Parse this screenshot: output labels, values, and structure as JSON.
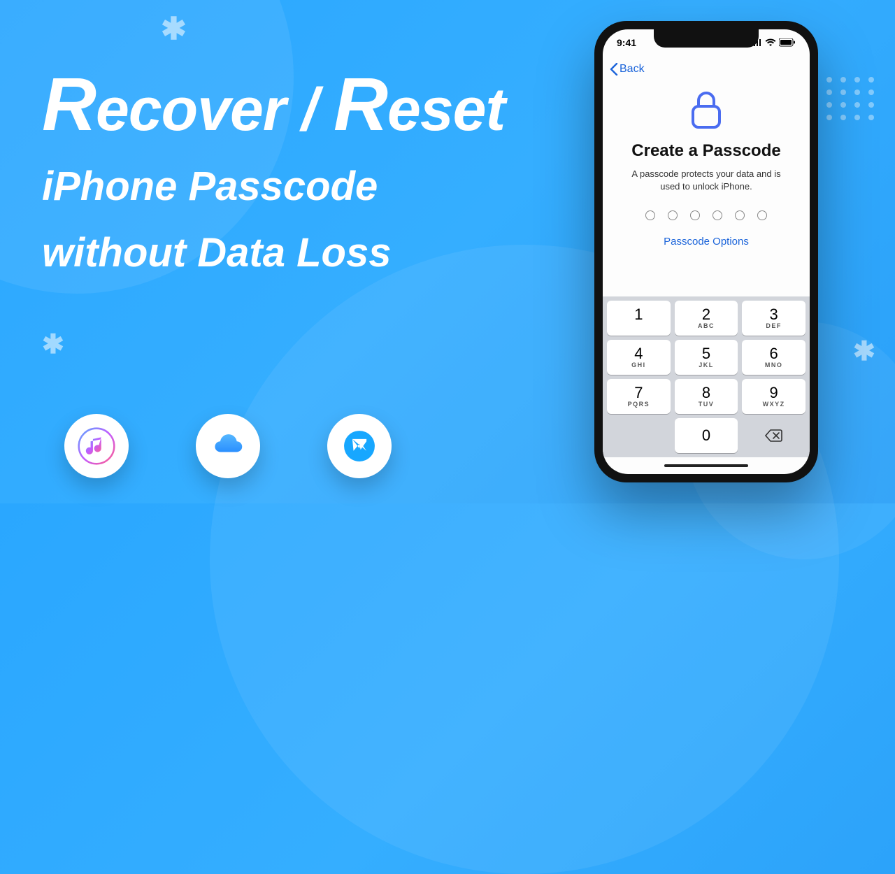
{
  "hero": {
    "line1_a": "R",
    "line1_b": "ecover / ",
    "line1_c": "R",
    "line1_d": "eset",
    "line2": "iPhone Passcode",
    "line3": "without Data Loss"
  },
  "apps": [
    "iTunes",
    "iCloud",
    "MobileTrans"
  ],
  "phone": {
    "status_time": "9:41",
    "back": "Back",
    "title": "Create a Passcode",
    "subtitle": "A passcode protects your data and is used to unlock iPhone.",
    "options": "Passcode Options",
    "keys": [
      {
        "n": "1",
        "l": ""
      },
      {
        "n": "2",
        "l": "ABC"
      },
      {
        "n": "3",
        "l": "DEF"
      },
      {
        "n": "4",
        "l": "GHI"
      },
      {
        "n": "5",
        "l": "JKL"
      },
      {
        "n": "6",
        "l": "MNO"
      },
      {
        "n": "7",
        "l": "PQRS"
      },
      {
        "n": "8",
        "l": "TUV"
      },
      {
        "n": "9",
        "l": "WXYZ"
      }
    ],
    "zero": "0"
  }
}
